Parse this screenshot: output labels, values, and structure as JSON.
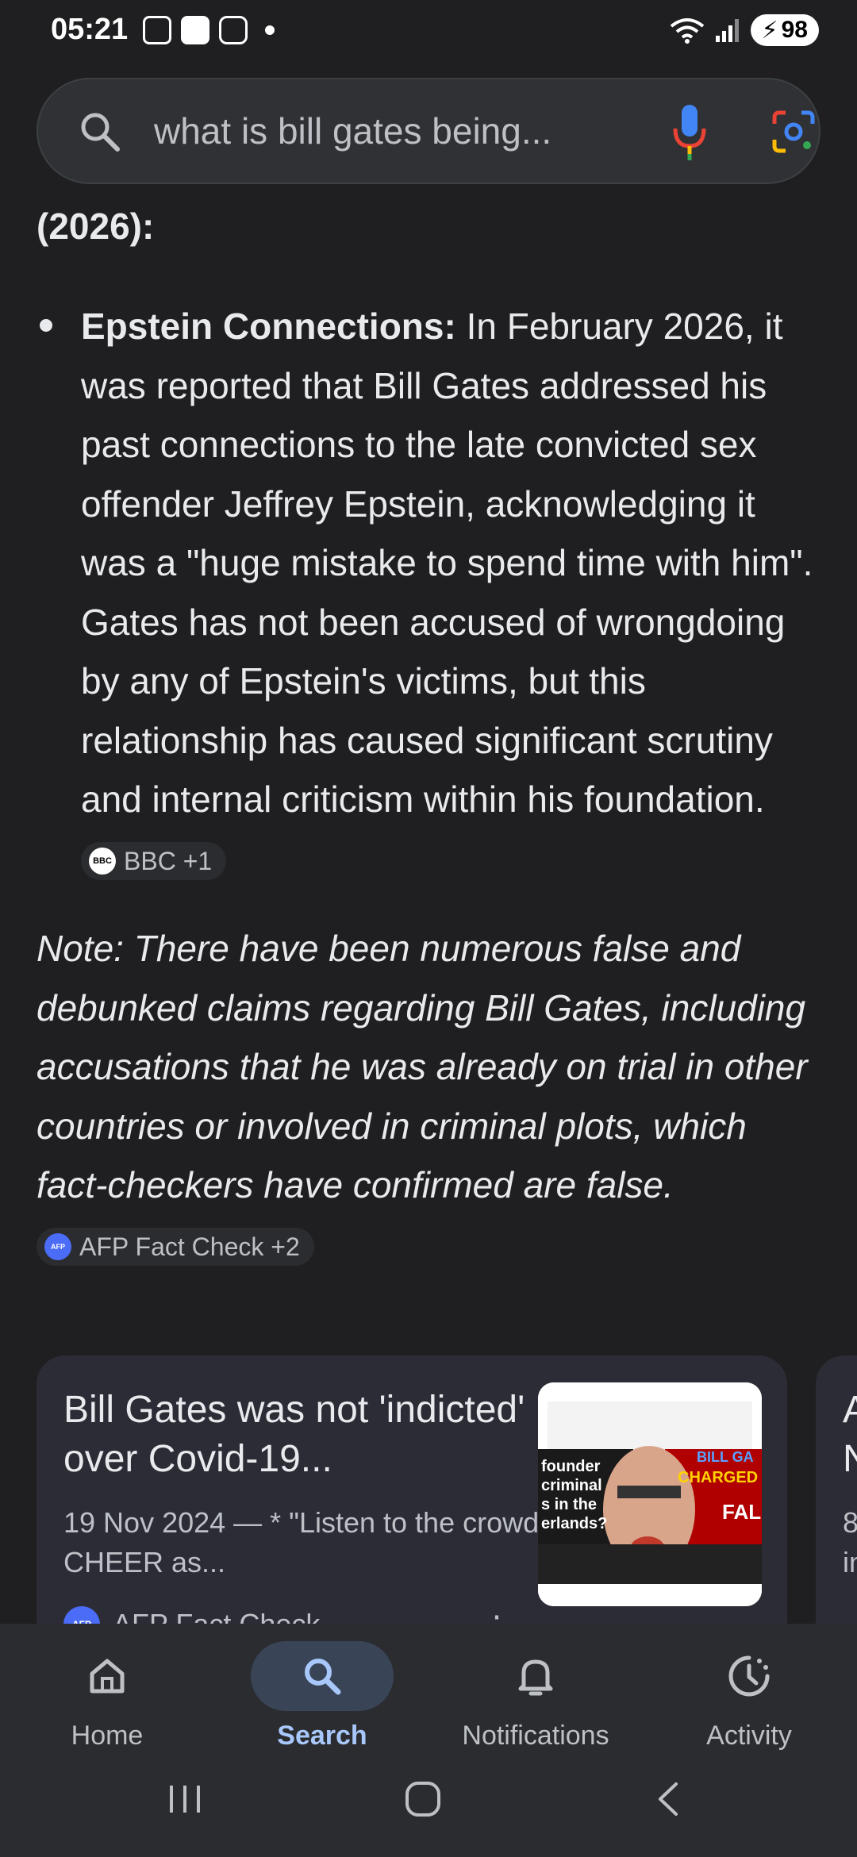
{
  "status_bar": {
    "time": "05:21",
    "battery": "98",
    "wifi_label": "5"
  },
  "search": {
    "query": "what is bill gates being..."
  },
  "content": {
    "heading_fragment": "(2026):",
    "bullet": {
      "title": "Epstein Connections:",
      "text": " In February 2026, it was reported that Bill Gates addressed his past connections to the late convicted sex offender Jeffrey Epstein, acknowledging it was a \"huge mistake to spend time with him\". Gates has not been accused of wrongdoing by any of Epstein's victims, but this relationship has caused significant scrutiny and internal criticism within his foundation. ",
      "source_chip": "BBC +1"
    },
    "note": {
      "text": "Note: There have been numerous false and debunked claims regarding Bill Gates, including accusations that he was already on trial in other countries or involved in criminal plots, which fact-checkers have confirmed are false. ",
      "source_chip": "AFP Fact Check +2"
    }
  },
  "cards": [
    {
      "title": "Bill Gates was not 'indicted' over Covid-19...",
      "snippet": "19 Nov 2024 — * \"Listen to the crowd CHEER as...",
      "source": "AFP Fact Check",
      "image_text": {
        "left": "founder criminal s in the erlands?",
        "right_top": "BILL GA",
        "right_mid": "CHARGED",
        "right_bot": "FAL"
      }
    },
    {
      "title": "A N",
      "snippet": "8 in"
    }
  ],
  "bottom_nav": {
    "items": [
      {
        "label": "Home",
        "icon": "home-icon"
      },
      {
        "label": "Search",
        "icon": "search-icon"
      },
      {
        "label": "Notifications",
        "icon": "bell-icon"
      },
      {
        "label": "Activity",
        "icon": "activity-icon"
      }
    ],
    "active": "Search"
  },
  "colors": {
    "background": "#1f1f21",
    "accent": "#a8c7fa",
    "card": "#2b2c35"
  }
}
